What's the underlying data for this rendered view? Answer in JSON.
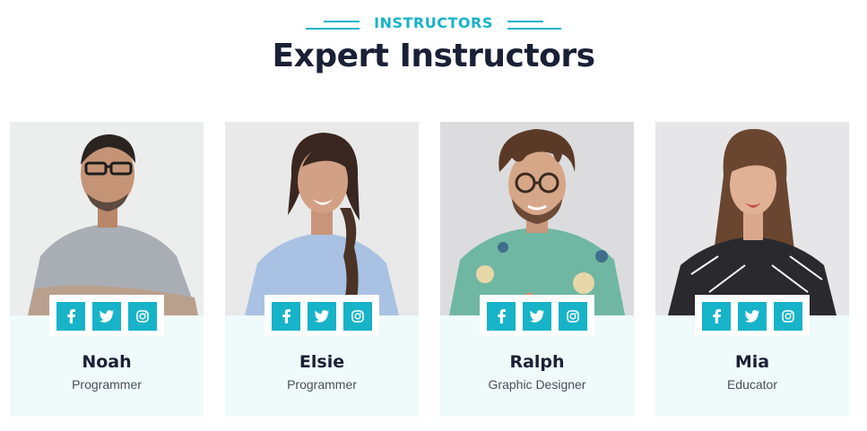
{
  "header": {
    "eyebrow": "INSTRUCTORS",
    "title": "Expert Instructors"
  },
  "colors": {
    "accent": "#17b3c8",
    "title": "#1a2035",
    "card_bg": "#effafb"
  },
  "instructors": [
    {
      "name": "Noah",
      "role": "Programmer",
      "photo_icon": "photo-man-glasses-gray-tshirt"
    },
    {
      "name": "Elsie",
      "role": "Programmer",
      "photo_icon": "photo-woman-braid-blue-shirt"
    },
    {
      "name": "Ralph",
      "role": "Graphic Designer",
      "photo_icon": "photo-man-curly-hair-floral-shirt"
    },
    {
      "name": "Mia",
      "role": "Educator",
      "photo_icon": "photo-woman-plaid-shirt"
    }
  ],
  "social_icons": [
    "facebook-icon",
    "twitter-icon",
    "instagram-icon"
  ]
}
